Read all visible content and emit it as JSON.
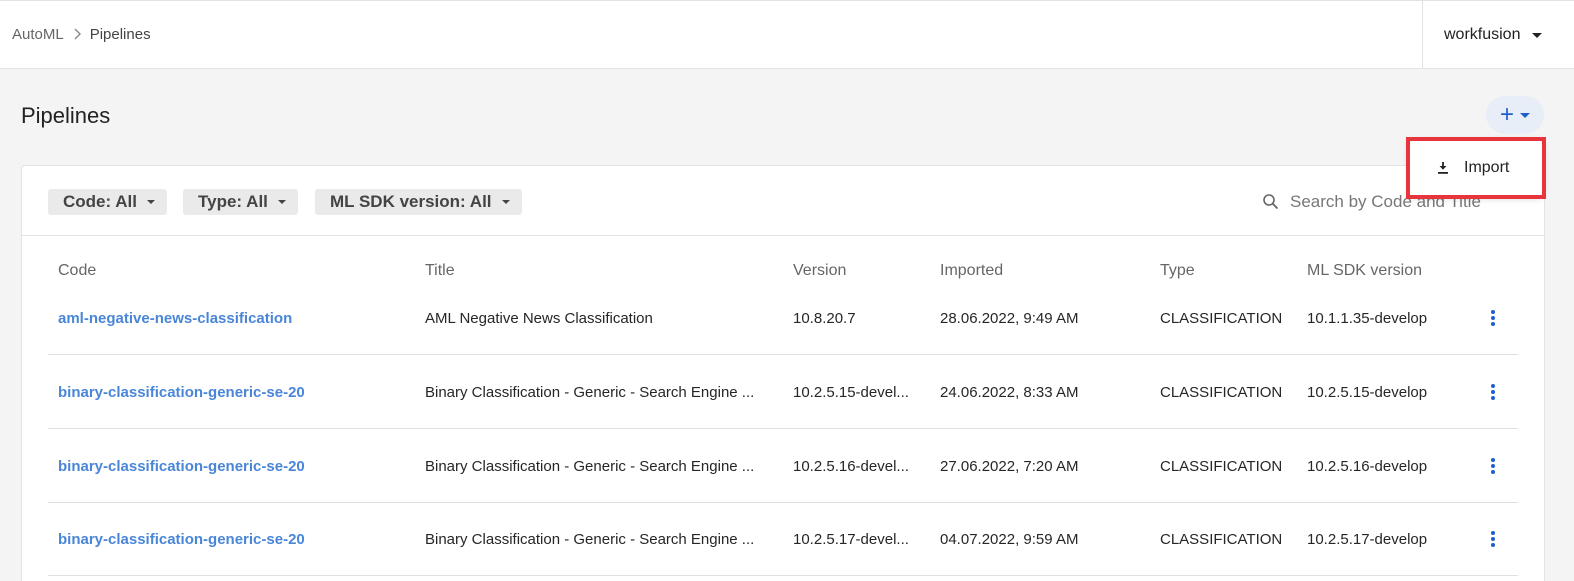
{
  "breadcrumb": {
    "root": "AutoML",
    "current": "Pipelines"
  },
  "tenant": {
    "name": "workfusion"
  },
  "page": {
    "title": "Pipelines"
  },
  "add_menu": {
    "items": [
      {
        "label": "Import",
        "icon": "download-icon"
      }
    ]
  },
  "filters": {
    "code": "Code: All",
    "type": "Type: All",
    "sdk": "ML SDK version: All"
  },
  "search": {
    "placeholder": "Search by Code and Title",
    "value": ""
  },
  "table": {
    "columns": [
      "Code",
      "Title",
      "Version",
      "Imported",
      "Type",
      "ML SDK version"
    ],
    "rows": [
      {
        "code": "aml-negative-news-classification",
        "title": "AML Negative News Classification",
        "version": "10.8.20.7",
        "imported": "28.06.2022, 9:49 AM",
        "type": "CLASSIFICATION",
        "sdk": "10.1.1.35-develop"
      },
      {
        "code": "binary-classification-generic-se-20",
        "title": "Binary Classification - Generic - Search Engine ...",
        "version": "10.2.5.15-devel...",
        "imported": "24.06.2022, 8:33 AM",
        "type": "CLASSIFICATION",
        "sdk": "10.2.5.15-develop"
      },
      {
        "code": "binary-classification-generic-se-20",
        "title": "Binary Classification - Generic - Search Engine ...",
        "version": "10.2.5.16-devel...",
        "imported": "27.06.2022, 7:20 AM",
        "type": "CLASSIFICATION",
        "sdk": "10.2.5.16-develop"
      },
      {
        "code": "binary-classification-generic-se-20",
        "title": "Binary Classification - Generic - Search Engine ...",
        "version": "10.2.5.17-devel...",
        "imported": "04.07.2022, 9:59 AM",
        "type": "CLASSIFICATION",
        "sdk": "10.2.5.17-develop"
      }
    ]
  },
  "colors": {
    "accent": "#1f5fcc",
    "link": "#4a86d8",
    "highlight": "#e8343c"
  }
}
